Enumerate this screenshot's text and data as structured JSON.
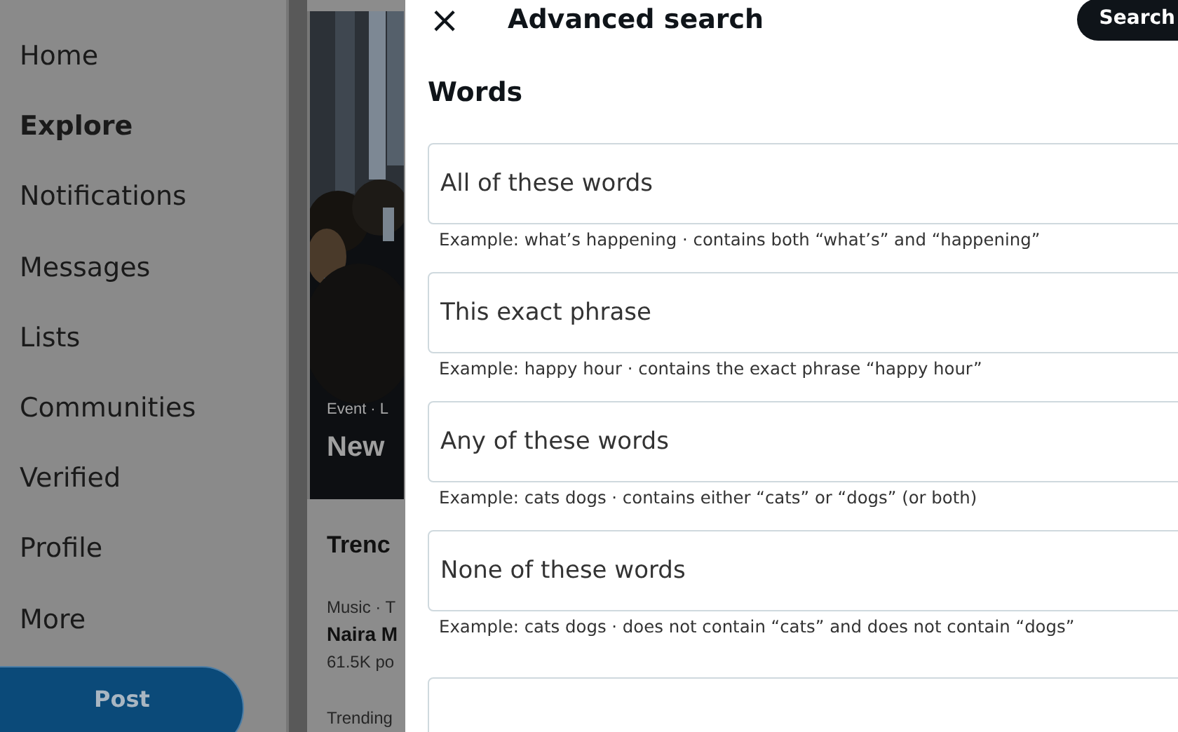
{
  "sidebar": {
    "items": [
      {
        "label": "Home",
        "selected": false
      },
      {
        "label": "Explore",
        "selected": true
      },
      {
        "label": "Notifications",
        "selected": false
      },
      {
        "label": "Messages",
        "selected": false
      },
      {
        "label": "Lists",
        "selected": false
      },
      {
        "label": "Communities",
        "selected": false
      },
      {
        "label": "Verified",
        "selected": false
      },
      {
        "label": "Profile",
        "selected": false
      },
      {
        "label": "More",
        "selected": false
      }
    ],
    "post_button": "Post"
  },
  "explore": {
    "featured": {
      "kind": "picture",
      "meta": "Event · L",
      "title": "New"
    },
    "trends_heading": "Trenc",
    "trends": [
      {
        "meta": "Music · T",
        "name": "Naira M",
        "count": "61.5K po"
      },
      {
        "meta": "Trending"
      }
    ]
  },
  "dialog": {
    "close": "×",
    "title": "Advanced search",
    "search_button": "Search",
    "section": "Words",
    "fields": [
      {
        "placeholder": "All of these words",
        "hint": "Example: what’s happening · contains both “what’s” and “happening”"
      },
      {
        "placeholder": "This exact phrase",
        "hint": "Example: happy hour · contains the exact phrase “happy hour”"
      },
      {
        "placeholder": "Any of these words",
        "hint": "Example: cats dogs · contains either “cats” or “dogs” (or both)"
      },
      {
        "placeholder": "None of these words",
        "hint": "Example: cats dogs · does not contain “cats” and does not contain “dogs”"
      },
      {
        "cut_off": true
      }
    ]
  }
}
